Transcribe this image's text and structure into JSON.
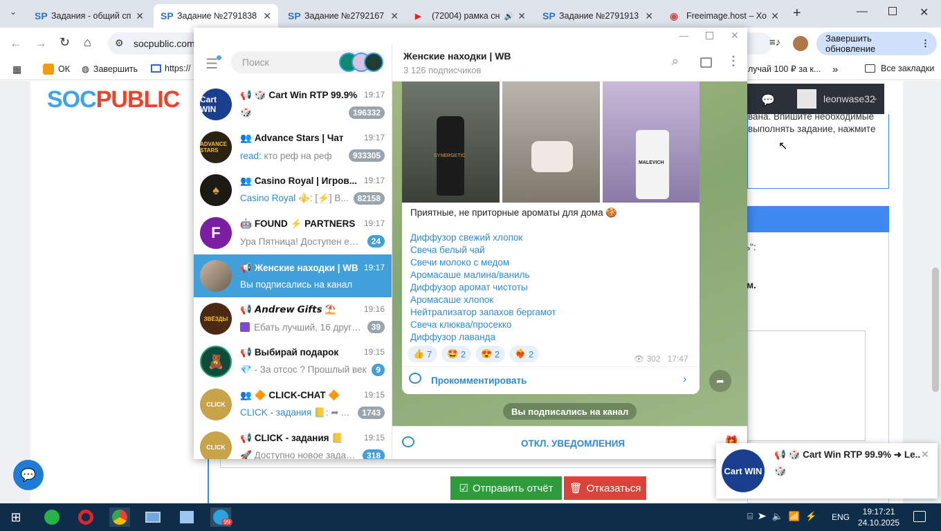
{
  "browser": {
    "tabs": [
      {
        "title": "Задания - общий сп",
        "fav": "SP"
      },
      {
        "title": "Задание №2791838",
        "fav": "SP"
      },
      {
        "title": "Задание №2792167",
        "fav": "SP"
      },
      {
        "title": "(72004) рамка сн",
        "fav": "▶"
      },
      {
        "title": "Задание №2791913",
        "fav": "SP"
      },
      {
        "title": "Freeimage.host – Хо",
        "fav": "◉"
      }
    ],
    "url": "socpublic.com",
    "update_label": "Завершить обновление",
    "bookmarks": {
      "ok": "ОК",
      "finish": "Завершить",
      "https": "https://",
      "promo": "лучай 100 ₽ за к...",
      "all": "Все закладки"
    }
  },
  "site": {
    "logo_soc": "SOC",
    "logo_public": "PUBLIC",
    "username": "leonwase32",
    "text_line1": "вана. Впишите необходимые",
    "text_line2": "выполнять задание, нажмите",
    "text_line3": "ть\":",
    "text_line4": "ом.",
    "send_label": "Отправить отчёт",
    "refuse_label": "Отказаться"
  },
  "telegram": {
    "search_placeholder": "Поиск",
    "chats": [
      {
        "name": "🎲 Cart Win RTP 99.9%",
        "time": "19:17",
        "preview": "🎲",
        "preview_prefix": "",
        "badge": "196332",
        "icon": "📢",
        "avatar_bg": "#1a3f8f",
        "avatar_label": "Cart WIN"
      },
      {
        "name": "Advance Stars | Чат",
        "time": "19:17",
        "preview": "кто реф на реф",
        "preview_prefix": "read:",
        "badge": "933305",
        "icon": "👥",
        "avatar_bg": "#2b2214",
        "avatar_label": "ADVANCE STARS"
      },
      {
        "name": "Casino Royal | Игров...",
        "time": "19:17",
        "preview": "⚜️: [⚡] В...",
        "preview_prefix": "Casino Royal",
        "badge": "82158",
        "icon": "👥",
        "avatar_bg": "#1d1a14",
        "avatar_label": "♠"
      },
      {
        "name": "FOUND ⚡ PARTNERS",
        "time": "19:17",
        "preview": "Ура Пятница! Доступен еж...",
        "preview_prefix": "",
        "badge": "24",
        "icon": "🤖",
        "avatar_bg": "#7b1fa2",
        "avatar_label": "F"
      },
      {
        "name": "Женские находки | WB",
        "time": "19:17",
        "preview": "Вы подписались на канал",
        "preview_prefix": "",
        "badge": "",
        "icon": "📢",
        "avatar_bg": "#8a7a6a",
        "avatar_label": ""
      },
      {
        "name": "𝘼𝙣𝙙𝙧𝙚𝙬 𝙂𝙞𝙛𝙩𝙨 ⛱️",
        "time": "19:16",
        "preview": "Ебать лучший, 16 друго...",
        "preview_prefix": "",
        "badge": "39",
        "icon": "📢",
        "avatar_bg": "#4a2a14",
        "avatar_label": "ЗВЁЗДЫ"
      },
      {
        "name": "Выбирай подарок",
        "time": "19:15",
        "preview": "💎 - За отсос ? Прошлый век",
        "preview_prefix": "",
        "badge": "9",
        "icon": "📢",
        "avatar_bg": "#0f4a3a",
        "avatar_label": "🧸"
      },
      {
        "name": "🔶 CLICK-CHAT 🔶",
        "time": "19:15",
        "preview": "📒: ➦ ...",
        "preview_prefix": "CLICK - задания",
        "badge": "1743",
        "icon": "👥",
        "avatar_bg": "#c9a24c",
        "avatar_label": "CLICK"
      },
      {
        "name": "CLICK - задания 📒",
        "time": "19:15",
        "preview": "🚀 Доступно новое задан...",
        "preview_prefix": "",
        "badge": "318",
        "icon": "📢",
        "avatar_bg": "#c9a24c",
        "avatar_label": "CLICK"
      }
    ],
    "channel": {
      "title": "Женские находки | WB",
      "subscribers": "3 126 подписчиков",
      "post_text": "Приятные, не приторные ароматы для дома 🍪",
      "links": [
        "Диффузор свежий хлопок",
        "Свеча белый чай",
        "Свечи молоко с медом",
        "Аромасаше малина/ваниль",
        "Диффузор аромат чистоты",
        "Аромасаше хлопок",
        "Нейтрализатор запахов бергамот",
        "Свеча клюква/просекко",
        "Диффузор лаванда"
      ],
      "reactions": [
        {
          "emoji": "👍",
          "count": "7"
        },
        {
          "emoji": "🤩",
          "count": "2"
        },
        {
          "emoji": "😍",
          "count": "2"
        },
        {
          "emoji": "❤️‍🔥",
          "count": "2"
        }
      ],
      "views": "302",
      "time": "17:47",
      "comment_label": "Прокомментировать",
      "service_message": "Вы подписались на канал",
      "mute_label": "ОТКЛ. УВЕДОМЛЕНИЯ",
      "img_labels": [
        "SYNERGETIC",
        "",
        "MALEVICH"
      ]
    },
    "notification": {
      "title": "📢 🎲 Cart Win RTP 99.9% ➜ Le...",
      "text": "🎲",
      "avatar_label": "Cart WIN"
    }
  },
  "taskbar": {
    "lang": "ENG",
    "time": "19:17:21",
    "date": "24.10.2025",
    "tg_badge": "99"
  },
  "colors": {
    "accent": "#419fd9",
    "link": "#2e8ad0",
    "site_blue": "#3f88f0",
    "green_btn": "#2e9c3c",
    "red_btn": "#d9443a"
  }
}
